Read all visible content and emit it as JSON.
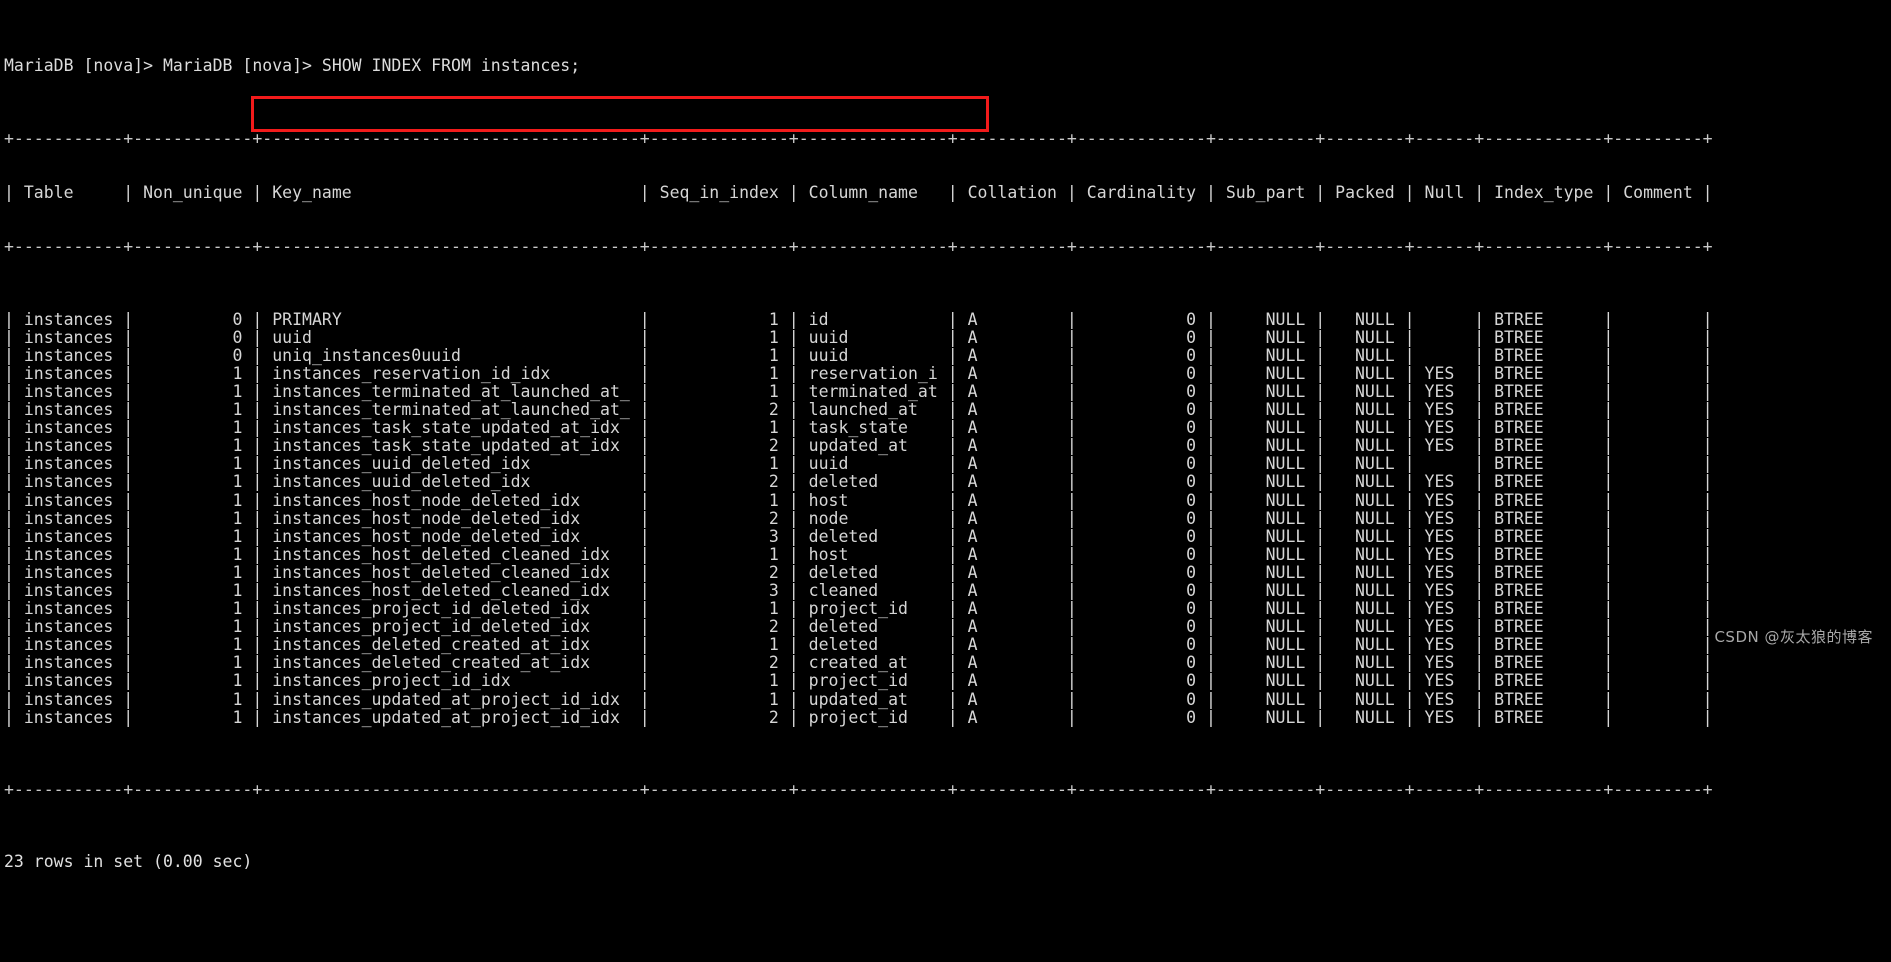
{
  "terminal": {
    "prompt_line": "MariaDB [nova]> MariaDB [nova]> SHOW INDEX FROM instances;",
    "status_line": "23 rows in set (0.00 sec)",
    "watermark": "CSDN @灰太狼的博客",
    "background_color": "#000000",
    "text_color": "#d6d6d6",
    "highlight_color": "#f21b1b"
  },
  "table": {
    "columns": [
      {
        "name": "Table",
        "width": 11,
        "align": "left"
      },
      {
        "name": "Non_unique",
        "width": 12,
        "align": "right"
      },
      {
        "name": "Key_name",
        "width": 38,
        "align": "left"
      },
      {
        "name": "Seq_in_index",
        "width": 14,
        "align": "right"
      },
      {
        "name": "Column_name",
        "width": 15,
        "align": "left"
      },
      {
        "name": "Collation",
        "width": 11,
        "align": "left"
      },
      {
        "name": "Cardinality",
        "width": 13,
        "align": "right"
      },
      {
        "name": "Sub_part",
        "width": 10,
        "align": "right"
      },
      {
        "name": "Packed",
        "width": 8,
        "align": "right"
      },
      {
        "name": "Null",
        "width": 6,
        "align": "left"
      },
      {
        "name": "Index_type",
        "width": 12,
        "align": "left"
      },
      {
        "name": "Comment",
        "width": 9,
        "align": "left"
      }
    ],
    "rows": [
      {
        "Table": "instances",
        "Non_unique": "0",
        "Key_name": "PRIMARY",
        "Seq_in_index": "1",
        "Column_name": "id",
        "Collation": "A",
        "Cardinality": "0",
        "Sub_part": "NULL",
        "Packed": "NULL",
        "Null": "",
        "Index_type": "BTREE",
        "Comment": "",
        "highlighted": false
      },
      {
        "Table": "instances",
        "Non_unique": "0",
        "Key_name": "uuid",
        "Seq_in_index": "1",
        "Column_name": "uuid",
        "Collation": "A",
        "Cardinality": "0",
        "Sub_part": "NULL",
        "Packed": "NULL",
        "Null": "",
        "Index_type": "BTREE",
        "Comment": "",
        "highlighted": true
      },
      {
        "Table": "instances",
        "Non_unique": "0",
        "Key_name": "uniq_instances0uuid",
        "Seq_in_index": "1",
        "Column_name": "uuid",
        "Collation": "A",
        "Cardinality": "0",
        "Sub_part": "NULL",
        "Packed": "NULL",
        "Null": "",
        "Index_type": "BTREE",
        "Comment": "",
        "highlighted": true
      },
      {
        "Table": "instances",
        "Non_unique": "1",
        "Key_name": "instances_reservation_id_idx",
        "Seq_in_index": "1",
        "Column_name": "reservation_id",
        "Collation": "A",
        "Cardinality": "0",
        "Sub_part": "NULL",
        "Packed": "NULL",
        "Null": "YES",
        "Index_type": "BTREE",
        "Comment": "",
        "highlighted": false
      },
      {
        "Table": "instances",
        "Non_unique": "1",
        "Key_name": "instances_terminated_at_launched_at_idx",
        "Seq_in_index": "1",
        "Column_name": "terminated_at",
        "Collation": "A",
        "Cardinality": "0",
        "Sub_part": "NULL",
        "Packed": "NULL",
        "Null": "YES",
        "Index_type": "BTREE",
        "Comment": "",
        "highlighted": false
      },
      {
        "Table": "instances",
        "Non_unique": "1",
        "Key_name": "instances_terminated_at_launched_at_idx",
        "Seq_in_index": "2",
        "Column_name": "launched_at",
        "Collation": "A",
        "Cardinality": "0",
        "Sub_part": "NULL",
        "Packed": "NULL",
        "Null": "YES",
        "Index_type": "BTREE",
        "Comment": "",
        "highlighted": false
      },
      {
        "Table": "instances",
        "Non_unique": "1",
        "Key_name": "instances_task_state_updated_at_idx",
        "Seq_in_index": "1",
        "Column_name": "task_state",
        "Collation": "A",
        "Cardinality": "0",
        "Sub_part": "NULL",
        "Packed": "NULL",
        "Null": "YES",
        "Index_type": "BTREE",
        "Comment": "",
        "highlighted": false
      },
      {
        "Table": "instances",
        "Non_unique": "1",
        "Key_name": "instances_task_state_updated_at_idx",
        "Seq_in_index": "2",
        "Column_name": "updated_at",
        "Collation": "A",
        "Cardinality": "0",
        "Sub_part": "NULL",
        "Packed": "NULL",
        "Null": "YES",
        "Index_type": "BTREE",
        "Comment": "",
        "highlighted": false
      },
      {
        "Table": "instances",
        "Non_unique": "1",
        "Key_name": "instances_uuid_deleted_idx",
        "Seq_in_index": "1",
        "Column_name": "uuid",
        "Collation": "A",
        "Cardinality": "0",
        "Sub_part": "NULL",
        "Packed": "NULL",
        "Null": "",
        "Index_type": "BTREE",
        "Comment": "",
        "highlighted": false
      },
      {
        "Table": "instances",
        "Non_unique": "1",
        "Key_name": "instances_uuid_deleted_idx",
        "Seq_in_index": "2",
        "Column_name": "deleted",
        "Collation": "A",
        "Cardinality": "0",
        "Sub_part": "NULL",
        "Packed": "NULL",
        "Null": "YES",
        "Index_type": "BTREE",
        "Comment": "",
        "highlighted": false
      },
      {
        "Table": "instances",
        "Non_unique": "1",
        "Key_name": "instances_host_node_deleted_idx",
        "Seq_in_index": "1",
        "Column_name": "host",
        "Collation": "A",
        "Cardinality": "0",
        "Sub_part": "NULL",
        "Packed": "NULL",
        "Null": "YES",
        "Index_type": "BTREE",
        "Comment": "",
        "highlighted": false
      },
      {
        "Table": "instances",
        "Non_unique": "1",
        "Key_name": "instances_host_node_deleted_idx",
        "Seq_in_index": "2",
        "Column_name": "node",
        "Collation": "A",
        "Cardinality": "0",
        "Sub_part": "NULL",
        "Packed": "NULL",
        "Null": "YES",
        "Index_type": "BTREE",
        "Comment": "",
        "highlighted": false
      },
      {
        "Table": "instances",
        "Non_unique": "1",
        "Key_name": "instances_host_node_deleted_idx",
        "Seq_in_index": "3",
        "Column_name": "deleted",
        "Collation": "A",
        "Cardinality": "0",
        "Sub_part": "NULL",
        "Packed": "NULL",
        "Null": "YES",
        "Index_type": "BTREE",
        "Comment": "",
        "highlighted": false
      },
      {
        "Table": "instances",
        "Non_unique": "1",
        "Key_name": "instances_host_deleted_cleaned_idx",
        "Seq_in_index": "1",
        "Column_name": "host",
        "Collation": "A",
        "Cardinality": "0",
        "Sub_part": "NULL",
        "Packed": "NULL",
        "Null": "YES",
        "Index_type": "BTREE",
        "Comment": "",
        "highlighted": false
      },
      {
        "Table": "instances",
        "Non_unique": "1",
        "Key_name": "instances_host_deleted_cleaned_idx",
        "Seq_in_index": "2",
        "Column_name": "deleted",
        "Collation": "A",
        "Cardinality": "0",
        "Sub_part": "NULL",
        "Packed": "NULL",
        "Null": "YES",
        "Index_type": "BTREE",
        "Comment": "",
        "highlighted": false
      },
      {
        "Table": "instances",
        "Non_unique": "1",
        "Key_name": "instances_host_deleted_cleaned_idx",
        "Seq_in_index": "3",
        "Column_name": "cleaned",
        "Collation": "A",
        "Cardinality": "0",
        "Sub_part": "NULL",
        "Packed": "NULL",
        "Null": "YES",
        "Index_type": "BTREE",
        "Comment": "",
        "highlighted": false
      },
      {
        "Table": "instances",
        "Non_unique": "1",
        "Key_name": "instances_project_id_deleted_idx",
        "Seq_in_index": "1",
        "Column_name": "project_id",
        "Collation": "A",
        "Cardinality": "0",
        "Sub_part": "NULL",
        "Packed": "NULL",
        "Null": "YES",
        "Index_type": "BTREE",
        "Comment": "",
        "highlighted": false
      },
      {
        "Table": "instances",
        "Non_unique": "1",
        "Key_name": "instances_project_id_deleted_idx",
        "Seq_in_index": "2",
        "Column_name": "deleted",
        "Collation": "A",
        "Cardinality": "0",
        "Sub_part": "NULL",
        "Packed": "NULL",
        "Null": "YES",
        "Index_type": "BTREE",
        "Comment": "",
        "highlighted": false
      },
      {
        "Table": "instances",
        "Non_unique": "1",
        "Key_name": "instances_deleted_created_at_idx",
        "Seq_in_index": "1",
        "Column_name": "deleted",
        "Collation": "A",
        "Cardinality": "0",
        "Sub_part": "NULL",
        "Packed": "NULL",
        "Null": "YES",
        "Index_type": "BTREE",
        "Comment": "",
        "highlighted": false
      },
      {
        "Table": "instances",
        "Non_unique": "1",
        "Key_name": "instances_deleted_created_at_idx",
        "Seq_in_index": "2",
        "Column_name": "created_at",
        "Collation": "A",
        "Cardinality": "0",
        "Sub_part": "NULL",
        "Packed": "NULL",
        "Null": "YES",
        "Index_type": "BTREE",
        "Comment": "",
        "highlighted": false
      },
      {
        "Table": "instances",
        "Non_unique": "1",
        "Key_name": "instances_project_id_idx",
        "Seq_in_index": "1",
        "Column_name": "project_id",
        "Collation": "A",
        "Cardinality": "0",
        "Sub_part": "NULL",
        "Packed": "NULL",
        "Null": "YES",
        "Index_type": "BTREE",
        "Comment": "",
        "highlighted": false
      },
      {
        "Table": "instances",
        "Non_unique": "1",
        "Key_name": "instances_updated_at_project_id_idx",
        "Seq_in_index": "1",
        "Column_name": "updated_at",
        "Collation": "A",
        "Cardinality": "0",
        "Sub_part": "NULL",
        "Packed": "NULL",
        "Null": "YES",
        "Index_type": "BTREE",
        "Comment": "",
        "highlighted": false
      },
      {
        "Table": "instances",
        "Non_unique": "1",
        "Key_name": "instances_updated_at_project_id_idx",
        "Seq_in_index": "2",
        "Column_name": "project_id",
        "Collation": "A",
        "Cardinality": "0",
        "Sub_part": "NULL",
        "Packed": "NULL",
        "Null": "YES",
        "Index_type": "BTREE",
        "Comment": "",
        "highlighted": false
      }
    ]
  }
}
